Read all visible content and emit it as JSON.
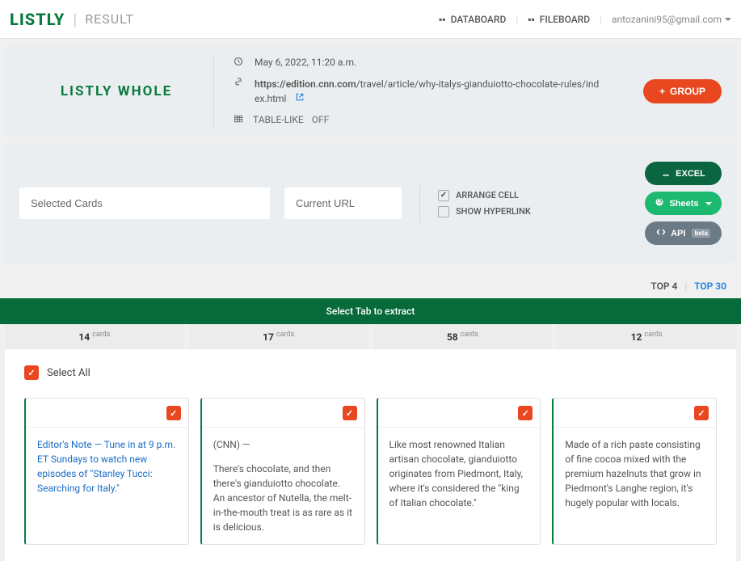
{
  "header": {
    "logo": "LISTLY",
    "section": "RESULT",
    "nav_databoard": "DATABOARD",
    "nav_fileboard": "FILEBOARD",
    "user_email": "antozanini95@gmail.com"
  },
  "info": {
    "whole_label": "LISTLY  WHOLE",
    "timestamp": "May 6, 2022, 11:20 a.m.",
    "url_domain": "https://edition.cnn.com",
    "url_path": "/travel/article/why-italys-gianduiotto-chocolate-rules/index.html",
    "table_like_label": "TABLE-LIKE",
    "table_like_value": "OFF",
    "group_btn": "GROUP"
  },
  "controls": {
    "selected_placeholder": "Selected Cards",
    "url_placeholder": "Current URL",
    "arrange_cell": "ARRANGE CELL",
    "show_hyperlink": "SHOW HYPERLINK",
    "excel_btn": "EXCEL",
    "sheets_btn": "Sheets",
    "api_btn": "API",
    "api_beta": "beta"
  },
  "top_links": {
    "top4": "TOP 4",
    "top30": "TOP 30"
  },
  "tabs": {
    "header": "Select Tab to extract",
    "items": [
      {
        "count": "14",
        "label": "cards"
      },
      {
        "count": "17",
        "label": "cards"
      },
      {
        "count": "58",
        "label": "cards"
      },
      {
        "count": "12",
        "label": "cards"
      }
    ]
  },
  "content": {
    "select_all": "Select All",
    "cards": [
      {
        "text1": "Editor's Note — Tune in at 9 p.m. ET Sundays to watch new episodes of \"Stanley Tucci: Searching for Italy.\"",
        "is_link": true
      },
      {
        "text1": "(CNN) —",
        "text2": "There's chocolate, and then there's gianduiotto chocolate. An ancestor of Nutella, the melt-in-the-mouth treat is as rare as it is delicious."
      },
      {
        "text1": "Like most renowned Italian artisan chocolate, gianduiotto originates from Piedmont, Italy, where it's considered the \"king of Italian chocolate.\""
      },
      {
        "text1": "Made of a rich paste consisting of fine cocoa mixed with the premium hazelnuts that grow in Piedmont's Langhe region, it's hugely popular with locals."
      }
    ]
  }
}
